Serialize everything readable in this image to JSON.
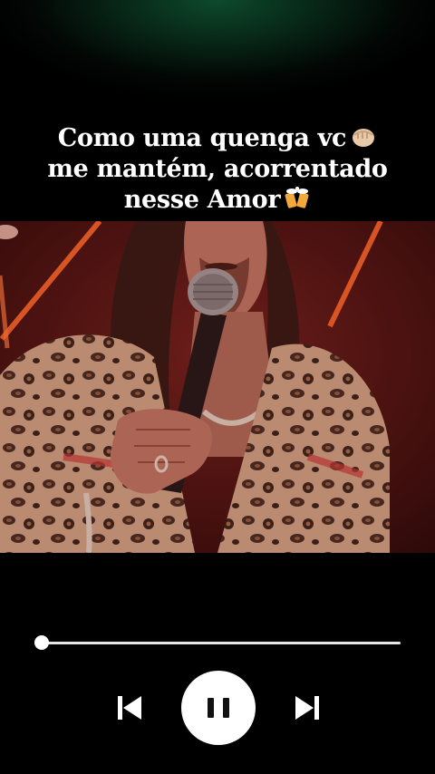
{
  "caption": {
    "line1": "Como uma quenga vc",
    "line2": "me mantém, acorrentado",
    "line3": "nesse Amor",
    "emoji1": "fist-bump-emoji",
    "emoji2": "beer-mugs-emoji"
  },
  "video": {
    "scene": "singer-with-microphone"
  },
  "player": {
    "progress_fraction": 0.0,
    "colors": {
      "background": "#000000",
      "track": "#e6e6e6",
      "button": "#ffffff",
      "icon": "#111111",
      "top_glow": "#0d4a2a"
    },
    "icons": {
      "previous": "skip-previous-icon",
      "pause": "pause-icon",
      "next": "skip-next-icon"
    }
  }
}
